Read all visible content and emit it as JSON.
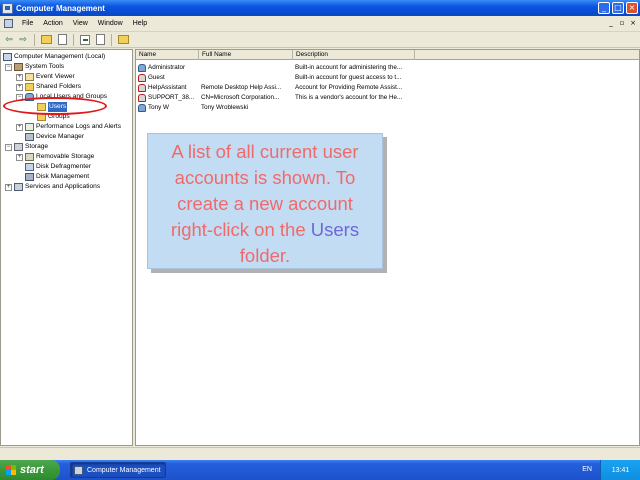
{
  "window": {
    "title": "Computer Management"
  },
  "window_buttons": {
    "minimize": "_",
    "maximize": "□",
    "close": "×"
  },
  "menu": {
    "items": [
      "File",
      "Action",
      "View",
      "Window",
      "Help"
    ]
  },
  "mdi_buttons": {
    "minimize": "_",
    "restore": "▫",
    "close": "×"
  },
  "toolbar": {
    "back": "⇦",
    "forward": "⇨"
  },
  "tree": {
    "root": "Computer Management (Local)",
    "system_tools": "System Tools",
    "event_viewer": "Event Viewer",
    "shared_folders": "Shared Folders",
    "local_users_groups": "Local Users and Groups",
    "users": "Users",
    "groups": "Groups",
    "performance": "Performance Logs and Alerts",
    "device_manager": "Device Manager",
    "storage": "Storage",
    "removable_storage": "Removable Storage",
    "disk_defragmenter": "Disk Defragmenter",
    "disk_management": "Disk Management",
    "services": "Services and Applications",
    "expander_collapsed": "+",
    "expander_expanded": "−"
  },
  "list": {
    "columns": {
      "name": "Name",
      "full_name": "Full Name",
      "description": "Description"
    },
    "rows": [
      {
        "name": "Administrator",
        "full_name": "",
        "description": "Built-in account for administering the..."
      },
      {
        "name": "Guest",
        "full_name": "",
        "description": "Built-in account for guest access to t..."
      },
      {
        "name": "HelpAssistant",
        "full_name": "Remote Desktop Help Assi...",
        "description": "Account for Providing Remote Assist..."
      },
      {
        "name": "SUPPORT_38...",
        "full_name": "CN=Microsoft Corporation...",
        "description": "This is a vendor's account for the He..."
      },
      {
        "name": "Tony W",
        "full_name": "Tony Wroblewski",
        "description": ""
      }
    ]
  },
  "callout": {
    "text_before": "A list of all current user accounts is shown. To create a new account right-click on the",
    "highlight": "Users",
    "text_after": "folder."
  },
  "taskbar": {
    "start": "start",
    "task": "Computer Management",
    "language": "EN",
    "clock": "13:41"
  },
  "colors": {
    "callout_text": "#f06a6a",
    "callout_highlight": "#6c68d8",
    "callout_background": "#c2dcf4",
    "annotation_oval": "#e0181c",
    "selection": "#316ac5"
  }
}
